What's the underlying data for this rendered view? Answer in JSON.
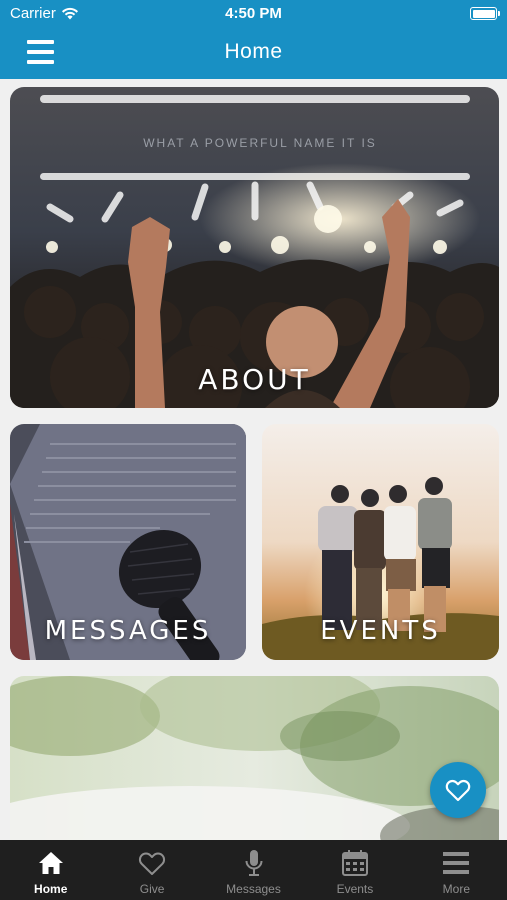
{
  "status_bar": {
    "carrier": "Carrier",
    "time": "4:50 PM",
    "wifi_icon": "wifi-icon",
    "battery_icon": "battery-icon"
  },
  "nav": {
    "title": "Home",
    "menu_icon": "hamburger-menu-icon"
  },
  "tiles": {
    "about": {
      "label": "ABOUT",
      "image": "concert-crowd-raised-hands-photo",
      "stage_text": "WHAT A POWERFUL NAME IT IS"
    },
    "messages": {
      "label": "MESSAGES",
      "image": "open-bible-and-microphone-photo"
    },
    "events": {
      "label": "EVENTS",
      "image": "friends-embracing-at-sunset-photo"
    },
    "bottom": {
      "label": "",
      "image": "blurred-plant-photo"
    }
  },
  "fab": {
    "icon": "heart-icon"
  },
  "tab_bar": {
    "items": [
      {
        "label": "Home",
        "icon": "home-icon",
        "active": true
      },
      {
        "label": "Give",
        "icon": "heart-icon",
        "active": false
      },
      {
        "label": "Messages",
        "icon": "microphone-icon",
        "active": false
      },
      {
        "label": "Events",
        "icon": "calendar-icon",
        "active": false
      },
      {
        "label": "More",
        "icon": "menu-lines-icon",
        "active": false
      }
    ]
  },
  "colors": {
    "brand": "#1890c4",
    "tab_bar_bg": "#1f1f1f",
    "tab_active": "#ffffff",
    "tab_inactive": "#8e8e8e"
  }
}
